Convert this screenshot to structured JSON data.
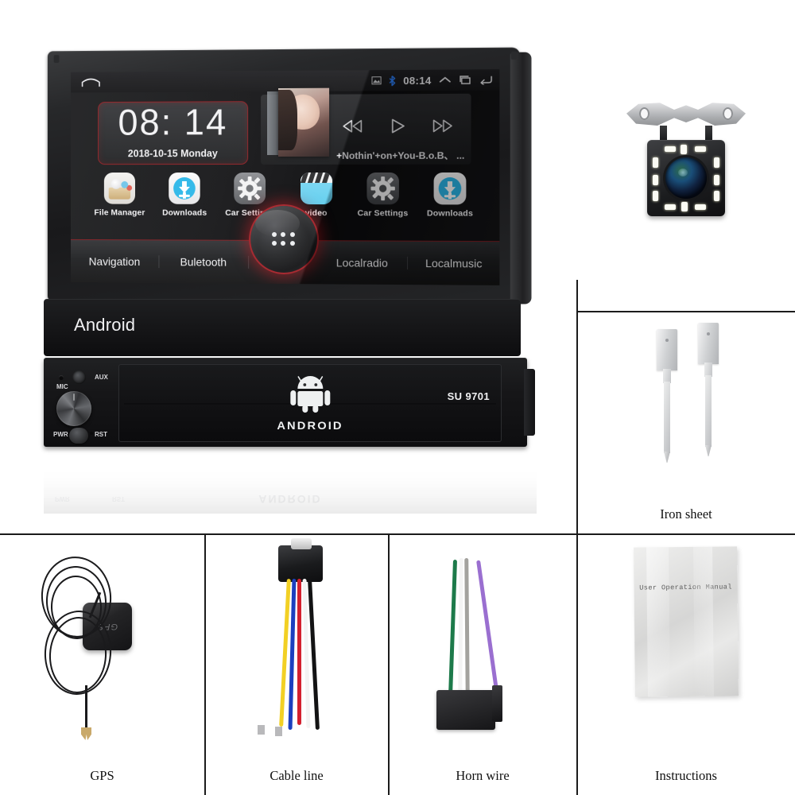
{
  "product": {
    "brand_plate": "Android",
    "model_number": "SU 9701",
    "logo_word": "ANDROID",
    "controls": {
      "mic": "MIC",
      "aux": "AUX",
      "power": "PWR",
      "reset": "RST"
    },
    "reflection": {
      "logo_word": "ANDROID",
      "power": "PWR",
      "reset": "RST"
    }
  },
  "screen": {
    "status_bar": {
      "clock": "08:14",
      "icons": [
        "screenshot-icon",
        "bluetooth-icon",
        "chevron-up-icon",
        "recents-icon",
        "back-icon"
      ],
      "home_icon": "home-icon"
    },
    "clock_widget": {
      "time": "08: 14",
      "date": "2018-10-15 Monday"
    },
    "media_widget": {
      "track_title": "+Nothin'+on+You-B.o.B、 ...",
      "buttons": [
        {
          "name": "previous-track",
          "glyph": "prev-icon"
        },
        {
          "name": "play",
          "glyph": "play-icon"
        },
        {
          "name": "next-track",
          "glyph": "next-icon"
        }
      ]
    },
    "apps": [
      {
        "label": "File Manager",
        "icon": "file-manager-icon"
      },
      {
        "label": "Downloads",
        "icon": "download-icon"
      },
      {
        "label": "Car Settings",
        "icon": "gear-icon"
      },
      {
        "label": "video",
        "icon": "clapperboard-icon"
      },
      {
        "label": "Car Settings",
        "icon": "gear-icon"
      },
      {
        "label": "Downloads",
        "icon": "download-icon"
      }
    ],
    "nav_bar": {
      "items": [
        "Navigation",
        "Buletooth",
        "Localradio",
        "Localmusic"
      ],
      "home_button_icon": "app-grid-icon"
    }
  },
  "accessories": [
    {
      "caption": "",
      "art": "backup-camera"
    },
    {
      "caption": "Iron sheet",
      "art": "iron-sheet"
    },
    {
      "caption": "GPS",
      "art": "gps-antenna"
    },
    {
      "caption": "Cable line",
      "art": "cable-line"
    },
    {
      "caption": "Horn wire",
      "art": "horn-wire"
    },
    {
      "caption": "Instructions",
      "art": "manual"
    }
  ],
  "manual": {
    "cover_title": "User Operation Manual"
  },
  "colors": {
    "accent_red": "#a51f26",
    "accent_blue": "#29b6e8",
    "bluetooth_blue": "#1f6fe0",
    "background": "#ffffff"
  }
}
